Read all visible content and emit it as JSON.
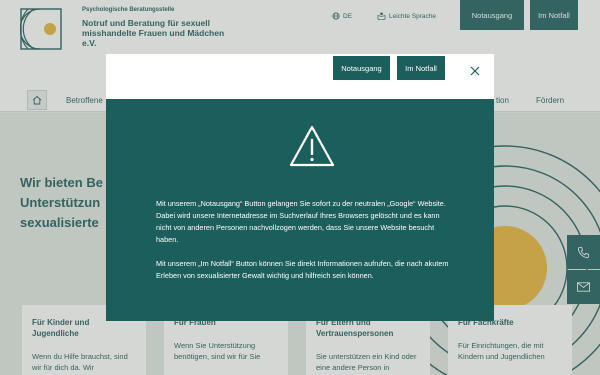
{
  "header": {
    "org_subtitle": "Psychologische Beratungsstelle",
    "org_title": "Notruf und Beratung für sexuell misshandelte Frauen und Mädchen e.V.",
    "language": "DE",
    "easy_language": "Leichte Sprache",
    "exit_button": "Notausgang",
    "emergency_button": "Im Notfall"
  },
  "nav": {
    "items": [
      "Betroffene",
      "tion",
      "Fördern"
    ]
  },
  "hero": {
    "title_lines": [
      "Wir bieten Be",
      "Unterstützun",
      "sexualisierte"
    ]
  },
  "cards": [
    {
      "title": "Für Kinder und Jugendliche",
      "text": "Wenn du Hilfe brauchst, sind wir für dich da. Wir"
    },
    {
      "title": "Für Frauen",
      "text": "Wenn Sie Unterstützung benötigen, sind wir für Sie"
    },
    {
      "title": "Für Eltern und Vertrauenspersonen",
      "text": "Sie unterstützen ein Kind oder eine andere Person in"
    },
    {
      "title": "Für Fachkräfte",
      "text": "Für Einrichtungen, die mit Kindern und Jugendlichen"
    }
  ],
  "modal": {
    "exit_button": "Notausgang",
    "emergency_button": "Im Notfall",
    "paragraph1": "Mit unserem „Notausgang“ Button gelangen Sie sofort zu der neutralen „Google“ Website. Dabei wird unsere Internetadresse im Suchverlauf Ihres Browsers gelöscht und es kann nicht von anderen Personen nachvollzogen werden, dass Sie unsere Website besucht haben.",
    "paragraph2": "Mit unserem „Im Notfall“ Button können Sie direkt Informationen aufrufen, die nach akutem Erleben von sexualisierter Gewalt wichtig und hilfreich sein können."
  },
  "colors": {
    "primary": "#1c5e5c",
    "accent_circle": "#e6b33a",
    "page_bg": "#dfe5df"
  },
  "icons": {
    "language": "globe-icon",
    "easy_language": "easy-read-icon",
    "home": "home-icon",
    "phone": "phone-icon",
    "mail": "mail-icon",
    "close": "close-icon",
    "warning": "warning-triangle-icon"
  }
}
